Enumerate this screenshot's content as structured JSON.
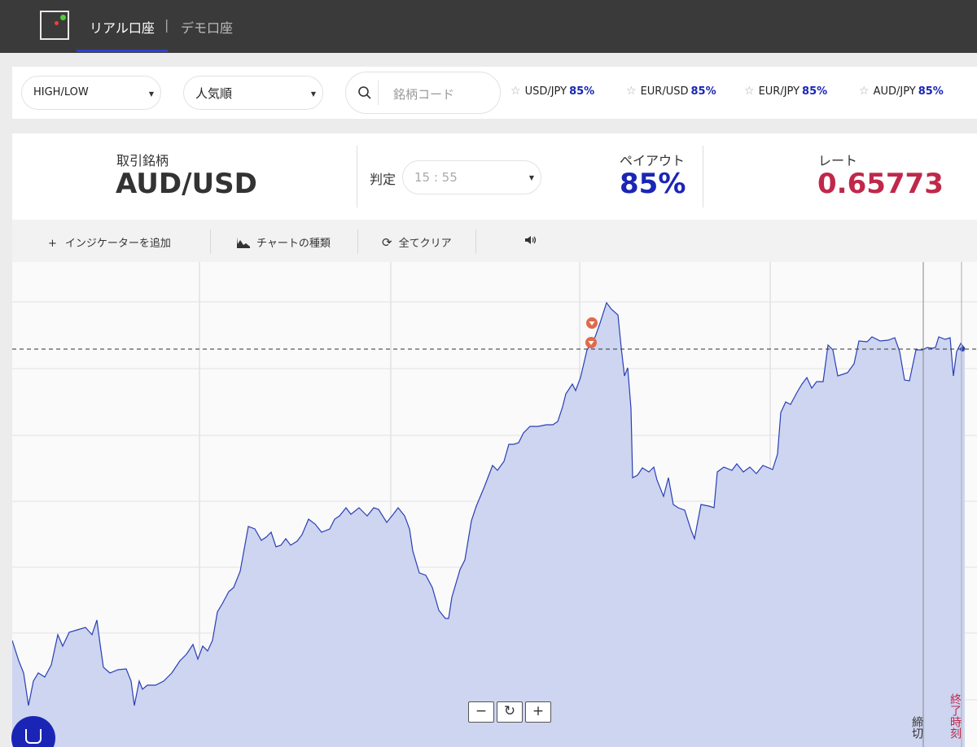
{
  "header": {
    "real_account": "リアル口座",
    "separator": "|",
    "demo_account": "デモ口座"
  },
  "filters": {
    "option_type": "HIGH/LOW",
    "sort": "人気順",
    "search_placeholder": "銘柄コード",
    "favorites": [
      {
        "symbol": "USD/JPY",
        "payout": "85%"
      },
      {
        "symbol": "EUR/USD",
        "payout": "85%"
      },
      {
        "symbol": "EUR/JPY",
        "payout": "85%"
      },
      {
        "symbol": "AUD/JPY",
        "payout": "85%"
      }
    ]
  },
  "info": {
    "asset_label": "取引銘柄",
    "asset_value": "AUD/USD",
    "judge_label": "判定",
    "judge_time": "15 : 55",
    "payout_label": "ペイアウト",
    "payout_value": "85%",
    "rate_label": "レート",
    "rate_value": "0.65773"
  },
  "toolbar": {
    "add_indicator": "インジケーターを追加",
    "chart_type": "チャートの種類",
    "clear_all": "全てクリア"
  },
  "chart": {
    "deadline_label": "締切",
    "expiry_label": "終了時刻",
    "zoom_out": "−",
    "zoom_reset": "↻",
    "zoom_in": "+"
  },
  "colors": {
    "accent": "#1a25b6",
    "rate": "#c0284a",
    "line": "#2a3fb5",
    "fill": "#cdd5f0",
    "marker": "#e06a4a"
  }
}
